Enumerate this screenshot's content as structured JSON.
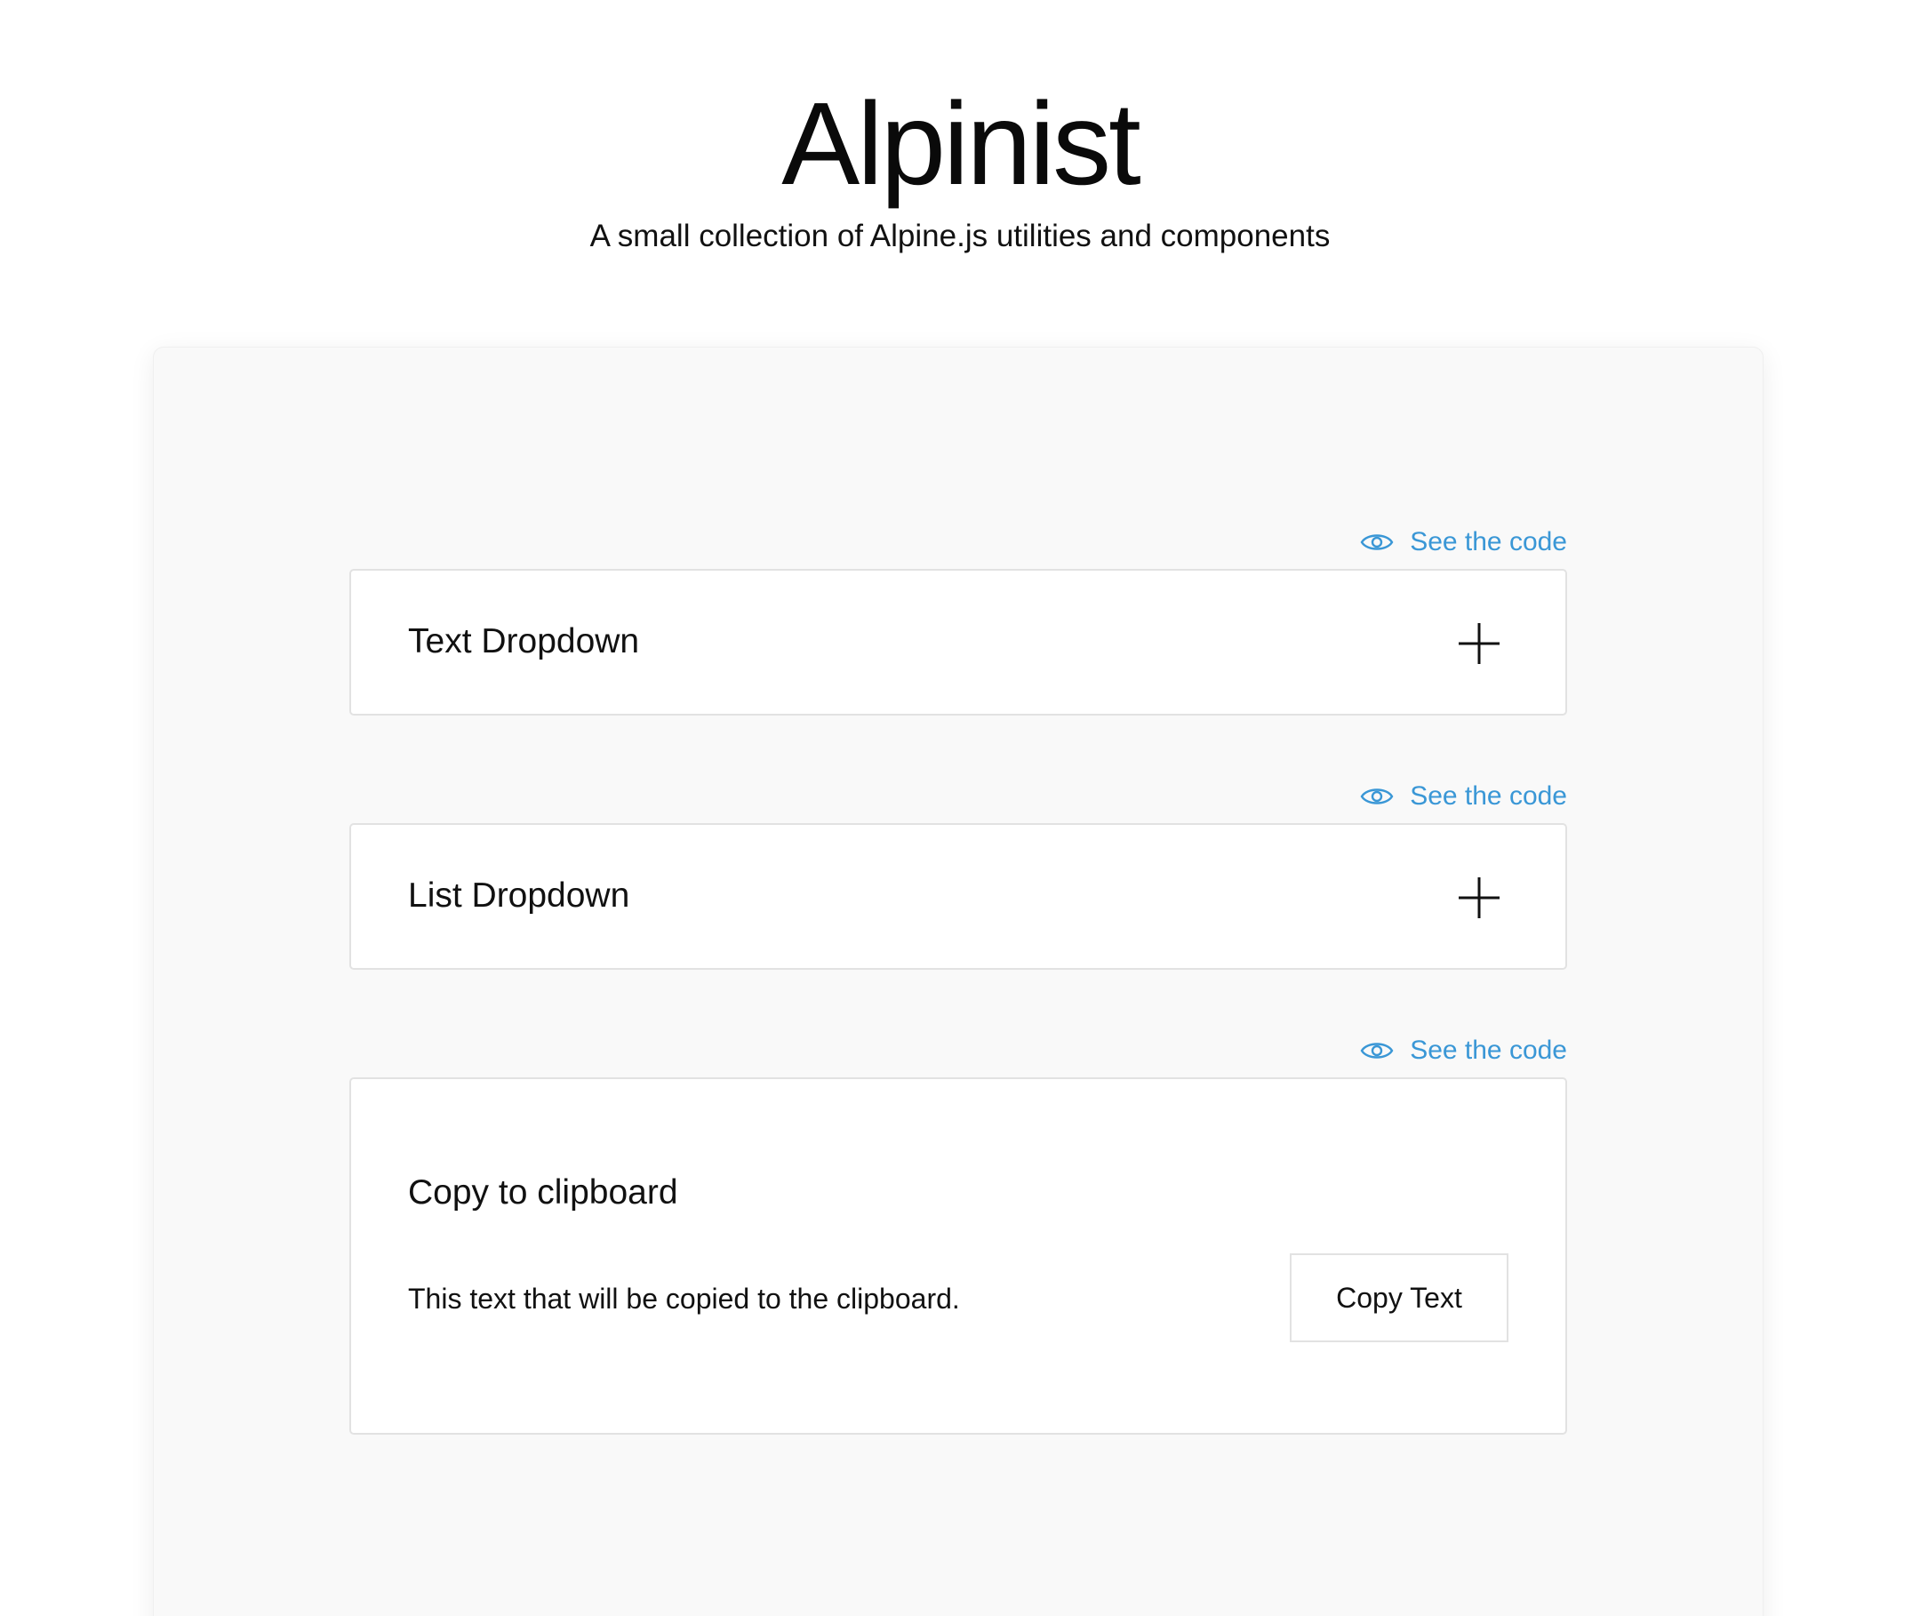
{
  "header": {
    "title": "Alpinist",
    "subtitle": "A small collection of Alpine.js utilities and components"
  },
  "components": [
    {
      "code_link_label": "See the code",
      "code_link_icon": "eye-icon",
      "title": "Text Dropdown",
      "toggle_icon": "plus-icon"
    },
    {
      "code_link_label": "See the code",
      "code_link_icon": "eye-icon",
      "title": "List Dropdown",
      "toggle_icon": "plus-icon"
    },
    {
      "code_link_label": "See the code",
      "code_link_icon": "eye-icon",
      "title": "Copy to clipboard",
      "body_text": "This text that will be copied to the clipboard.",
      "button_label": "Copy Text"
    }
  ],
  "colors": {
    "accent": "#3a97d6",
    "panel_background": "#f9f9f9",
    "card_border": "#e2e2e2"
  }
}
